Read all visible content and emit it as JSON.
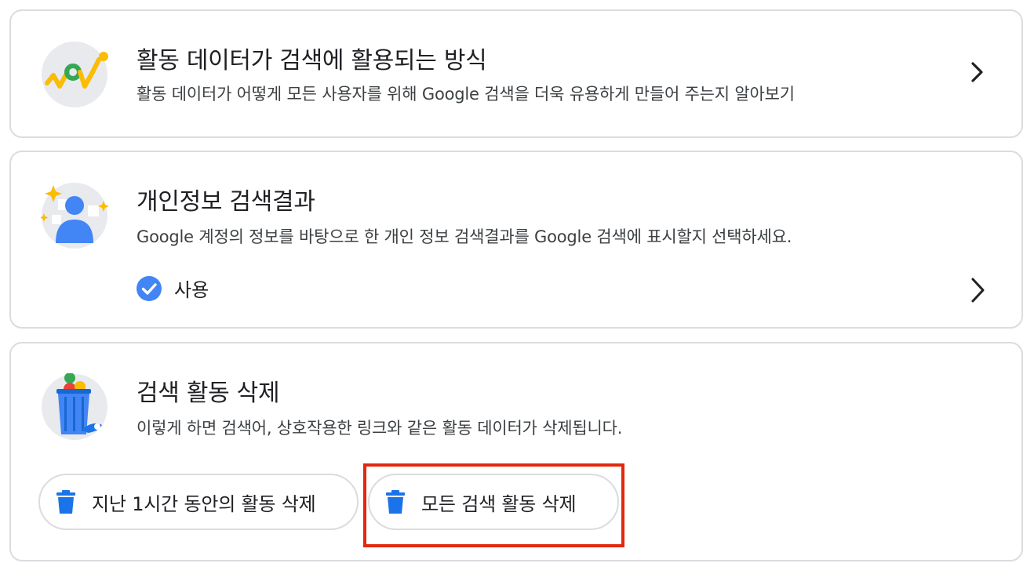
{
  "cards": {
    "activity_usage": {
      "title": "활동 데이터가 검색에 활용되는 방식",
      "description": "활동 데이터가 어떻게 모든 사용자를 위해 Google 검색을 더욱 유용하게 만들어 주는지 알아보기",
      "icon": "activity-graph-icon"
    },
    "personal_results": {
      "title": "개인정보 검색결과",
      "description": "Google 계정의 정보를 바탕으로 한 개인 정보 검색결과를 Google 검색에 표시할지 선택하세요.",
      "status": "사용",
      "icon": "personal-results-icon"
    },
    "delete_activity": {
      "title": "검색 활동 삭제",
      "description": "이렇게 하면 검색어, 상호작용한 링크와 같은 활동 데이터가 삭제됩니다.",
      "icon": "trash-bin-icon",
      "buttons": {
        "last_hour": "지난 1시간 동안의 활동 삭제",
        "all": "모든 검색 활동 삭제"
      }
    }
  },
  "colors": {
    "accent_blue": "#1a73e8",
    "highlight_red": "#e2280f",
    "border": "#dadce0",
    "yellow": "#fbbc04",
    "green": "#34a853"
  }
}
